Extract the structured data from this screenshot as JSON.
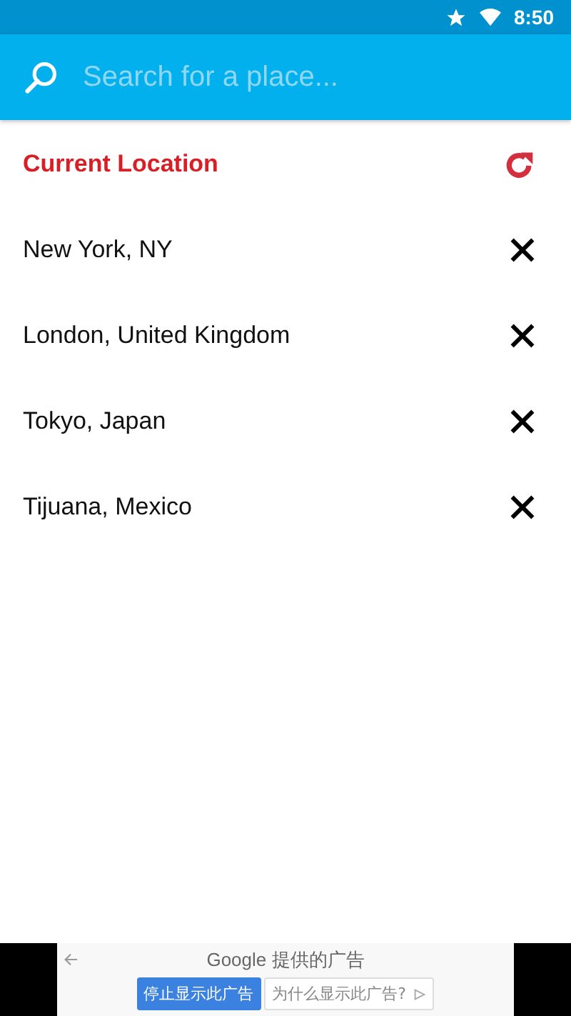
{
  "status_bar": {
    "time": "8:50"
  },
  "search": {
    "placeholder": "Search for a place..."
  },
  "locations": [
    {
      "kind": "current",
      "name": "Current Location"
    },
    {
      "kind": "saved",
      "name": "New York, NY"
    },
    {
      "kind": "saved",
      "name": "London, United Kingdom"
    },
    {
      "kind": "saved",
      "name": "Tokyo, Japan"
    },
    {
      "kind": "saved",
      "name": "Tijuana, Mexico"
    }
  ],
  "ad": {
    "label": "Google 提供的广告",
    "stop_button": "停止显示此广告",
    "why_button": "为什么显示此广告?"
  }
}
